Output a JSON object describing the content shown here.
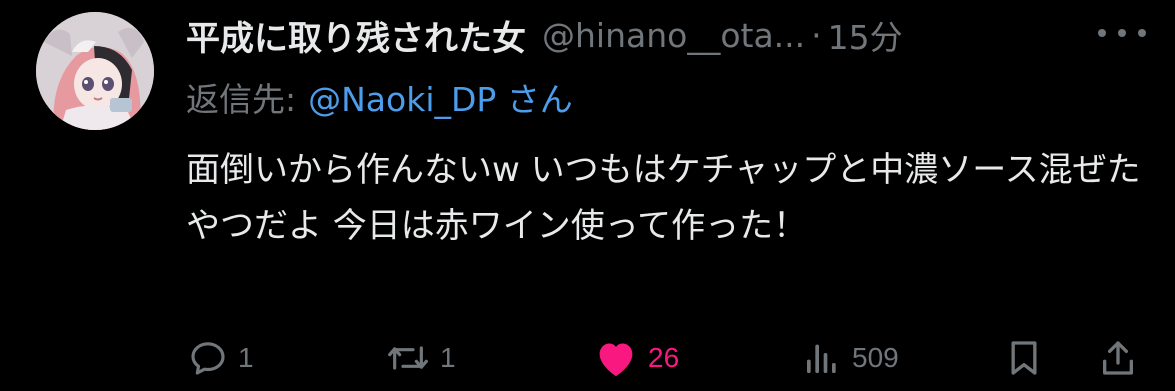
{
  "tweet": {
    "display_name": "平成に取り残された女",
    "handle": "@hinano__ota...",
    "separator": "·",
    "time": "15分",
    "reply_prefix": "返信先:",
    "reply_mention": "@Naoki_DP さん",
    "text": "面倒いから作んないw いつもはケチャップと中濃ソース混ぜたやつだよ 今日は赤ワイン使って作った！"
  },
  "actions": {
    "reply_count": "1",
    "retweet_count": "1",
    "like_count": "26",
    "view_count": "509"
  },
  "colors": {
    "background": "#000000",
    "text": "#e7e9ea",
    "muted": "#71767b",
    "link": "#4c9dec",
    "like": "#f91880"
  },
  "icons": [
    "more-icon",
    "reply-icon",
    "retweet-icon",
    "heart-icon",
    "views-icon",
    "bookmark-icon",
    "share-icon"
  ]
}
